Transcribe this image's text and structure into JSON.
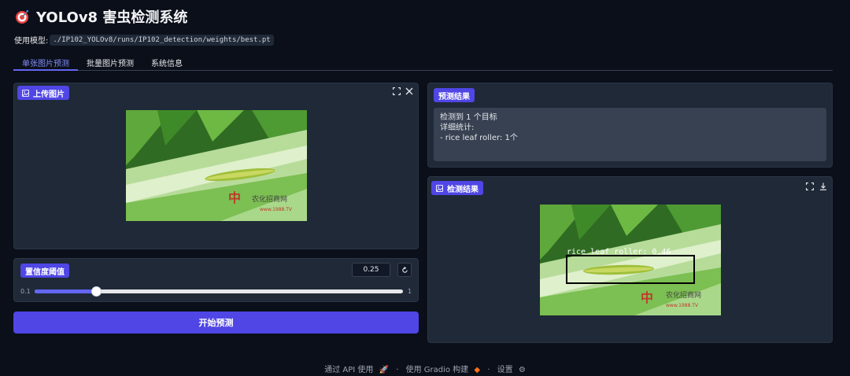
{
  "header": {
    "logo_icon": "target-icon",
    "title": "YOLOv8 害虫检测系统"
  },
  "model": {
    "label": "使用模型:",
    "path": "./IP102_YOLOv8/runs/IP102_detection/weights/best.pt"
  },
  "tabs": [
    {
      "label": "单张图片预测",
      "active": true
    },
    {
      "label": "批量图片预测",
      "active": false
    },
    {
      "label": "系统信息",
      "active": false
    }
  ],
  "upload": {
    "label": "上传图片",
    "icons": [
      "image-icon",
      "fullscreen-icon",
      "close-icon"
    ],
    "watermark_text": "农化招商网",
    "watermark_url": "www.1988.TV"
  },
  "confidence": {
    "label": "置信度阈值",
    "value": "0.25",
    "min": "0.1",
    "max": "1",
    "fraction": 0.1667
  },
  "predict_button": "开始预测",
  "results": {
    "label": "预测结果",
    "text": "检测到 1 个目标\n详细统计:\n- rice leaf roller: 1个"
  },
  "detection": {
    "label": "检测结果",
    "icons": [
      "image-icon",
      "fullscreen-icon",
      "download-icon"
    ],
    "box_label": "rice leaf roller: 0.46",
    "watermark_text": "农化招商网",
    "watermark_url": "www.1988.TV"
  },
  "footer": {
    "api": "通过 API 使用",
    "sep1": "·",
    "built": "使用 Gradio 构建",
    "sep2": "·",
    "settings": "设置"
  },
  "colors": {
    "accent": "#4f46e5",
    "background": "#0b0f19",
    "panel": "#1f2937"
  }
}
